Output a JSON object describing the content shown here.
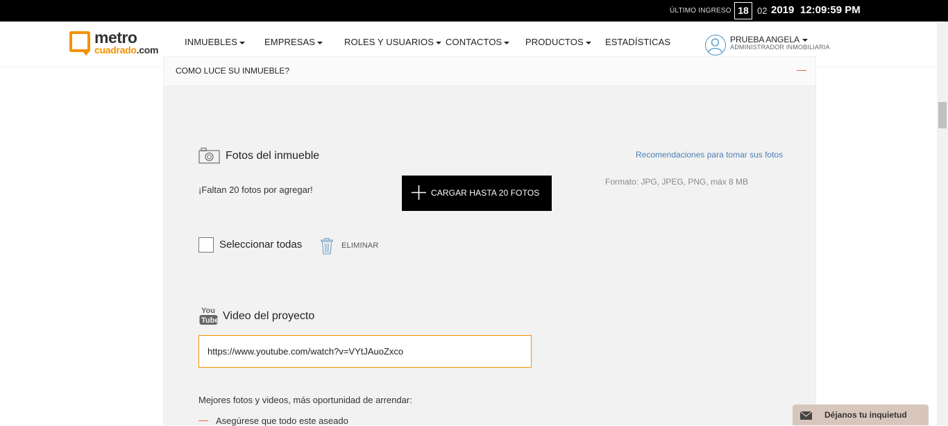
{
  "topbar": {
    "last_login_label": "ÚLTIMO INGRESO",
    "day": "18",
    "month": "02",
    "year": "2019",
    "time": "12:09:59 PM"
  },
  "header": {
    "logo_word1": "metro",
    "logo_word2a": "cuadrado",
    "logo_word2b": ".com",
    "nav": [
      "INMUEBLES",
      "EMPRESAS",
      "ROLES Y USUARIOS",
      "CONTACTOS",
      "PRODUCTOS",
      "ESTADÍSTICAS"
    ],
    "user_name": "PRUEBA ANGELA",
    "user_role": "ADMINISTRADOR INMOBILIARIA"
  },
  "section": {
    "title": "COMO LUCE SU INMUEBLE?"
  },
  "photos": {
    "title": "Fotos del inmueble",
    "recommendations_link": "Recomendaciones para tomar sus fotos",
    "missing_text": "¡Faltan 20 fotos por agregar!",
    "upload_button": "CARGAR HASTA 20 FOTOS",
    "format_text": "Formato: JPG, JPEG, PNG, máx 8 MB",
    "select_all": "Seleccionar todas",
    "delete": "ELIMINAR"
  },
  "video": {
    "title": "Video del proyecto",
    "url_value": "https://www.youtube.com/watch?v=VYtJAuoZxco"
  },
  "tips": {
    "title": "Mejores fotos y videos, más oportunidad de arrendar:",
    "items": [
      "Asegúrese que todo este aseado"
    ]
  },
  "feedback": {
    "label": "Déjanos tu inquietud"
  },
  "colors": {
    "accent_orange": "#f39200",
    "link_blue": "#4a7fb5",
    "dash_red": "#e8633b"
  }
}
